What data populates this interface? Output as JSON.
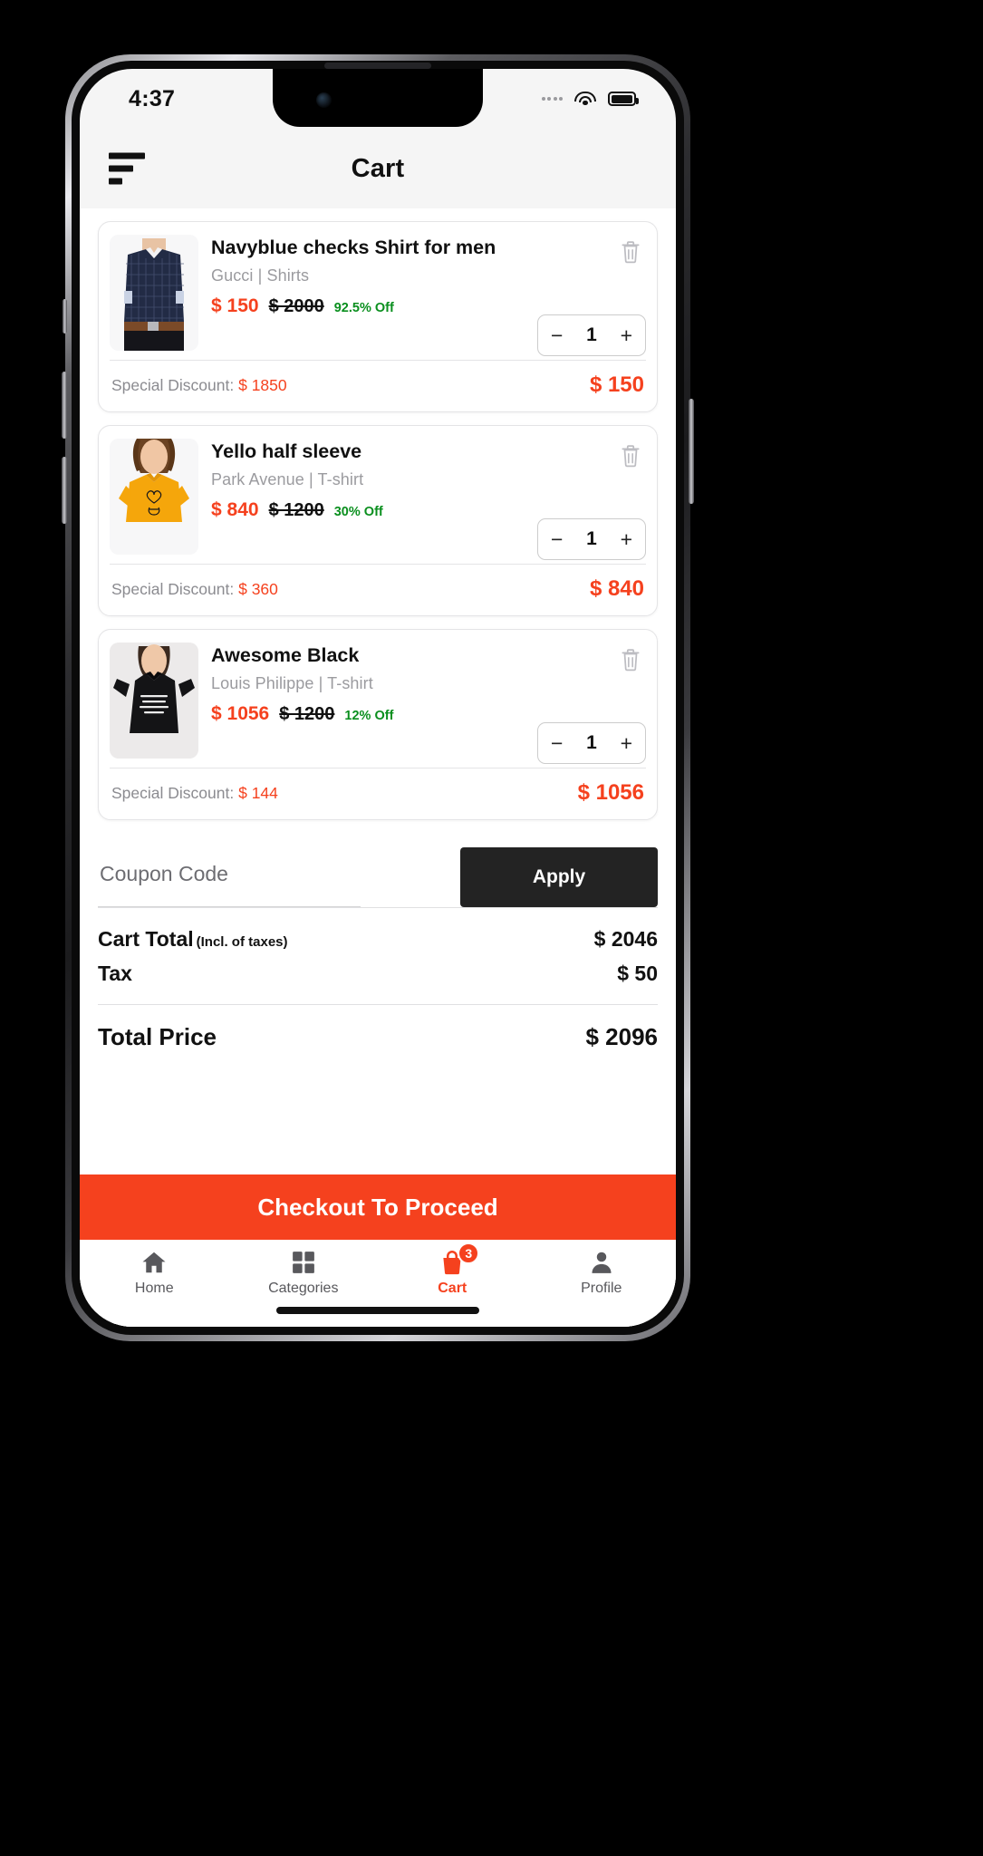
{
  "status_bar": {
    "time": "4:37",
    "signal_icon": "signal-dots-icon",
    "wifi_icon": "wifi-icon",
    "battery_icon": "battery-icon"
  },
  "header": {
    "menu_icon": "hamburger-menu-icon",
    "title": "Cart"
  },
  "colors": {
    "accent_red": "#f5411e",
    "discount_green": "#0a8f1e",
    "apply_button": "#232323",
    "muted_text": "#9b9b9f"
  },
  "cart_items": [
    {
      "title": "Navyblue checks Shirt for men",
      "brand_category": "Gucci | Shirts",
      "price": "$ 150",
      "original_price": "$ 2000",
      "discount_percent": "92.5% Off",
      "quantity": "1",
      "minus_label": "−",
      "plus_label": "+",
      "special_discount_label": "Special Discount:",
      "special_discount_value": "$ 1850",
      "line_total": "$ 150",
      "delete_icon": "trash-icon",
      "image_alt": "navyblue-checks-shirt-thumbnail"
    },
    {
      "title": "Yello half sleeve",
      "brand_category": "Park Avenue | T-shirt",
      "price": "$ 840",
      "original_price": "$ 1200",
      "discount_percent": "30% Off",
      "quantity": "1",
      "minus_label": "−",
      "plus_label": "+",
      "special_discount_label": "Special Discount:",
      "special_discount_value": "$ 360",
      "line_total": "$ 840",
      "delete_icon": "trash-icon",
      "image_alt": "yellow-half-sleeve-tshirt-thumbnail"
    },
    {
      "title": "Awesome Black",
      "brand_category": "Louis Philippe | T-shirt",
      "price": "$ 1056",
      "original_price": "$ 1200",
      "discount_percent": "12% Off",
      "quantity": "1",
      "minus_label": "−",
      "plus_label": "+",
      "special_discount_label": "Special Discount:",
      "special_discount_value": "$ 144",
      "line_total": "$ 1056",
      "delete_icon": "trash-icon",
      "image_alt": "awesome-black-tshirt-thumbnail"
    }
  ],
  "coupon": {
    "placeholder": "Coupon Code",
    "value": "",
    "apply_label": "Apply"
  },
  "totals": {
    "cart_total_label": "Cart Total",
    "cart_total_note": "(Incl. of taxes)",
    "cart_total_value": "$ 2046",
    "tax_label": "Tax",
    "tax_value": "$ 50",
    "grand_label": "Total Price",
    "grand_value": "$ 2096"
  },
  "checkout": {
    "label": "Checkout To Proceed"
  },
  "bottom_nav": {
    "items": [
      {
        "label": "Home",
        "icon": "home-icon",
        "active": false,
        "badge": ""
      },
      {
        "label": "Categories",
        "icon": "grid-icon",
        "active": false,
        "badge": ""
      },
      {
        "label": "Cart",
        "icon": "shopping-bag-icon",
        "active": true,
        "badge": "3"
      },
      {
        "label": "Profile",
        "icon": "person-icon",
        "active": false,
        "badge": ""
      }
    ]
  }
}
